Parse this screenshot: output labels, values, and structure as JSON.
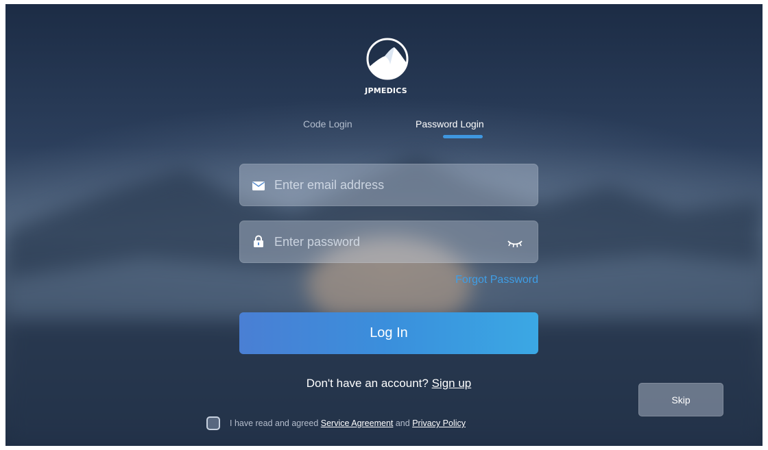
{
  "brand": {
    "name": "JPMEDICS"
  },
  "tabs": [
    {
      "label": "Code Login",
      "active": false
    },
    {
      "label": "Password Login",
      "active": true
    }
  ],
  "form": {
    "email_placeholder": "Enter email address",
    "email_value": "",
    "password_placeholder": "Enter password",
    "password_value": "",
    "forgot_label": "Forgot Password",
    "login_label": "Log In"
  },
  "signup": {
    "prompt": "Don't have an account?",
    "link_label": "Sign up"
  },
  "skip_label": "Skip",
  "agreement": {
    "prefix": "I have read and agreed",
    "service_label": "Service Agreement",
    "conjunction": "and",
    "privacy_label": "Privacy Policy",
    "checked": false
  },
  "icons": {
    "email": "envelope-icon",
    "password": "lock-icon",
    "visibility": "eye-closed-icon",
    "logo": "mountain-logo-icon"
  },
  "colors": {
    "accent": "#3f97e0",
    "link": "#3f9ee6",
    "button_start": "#4a7fd4",
    "button_end": "#3ba8e4"
  }
}
